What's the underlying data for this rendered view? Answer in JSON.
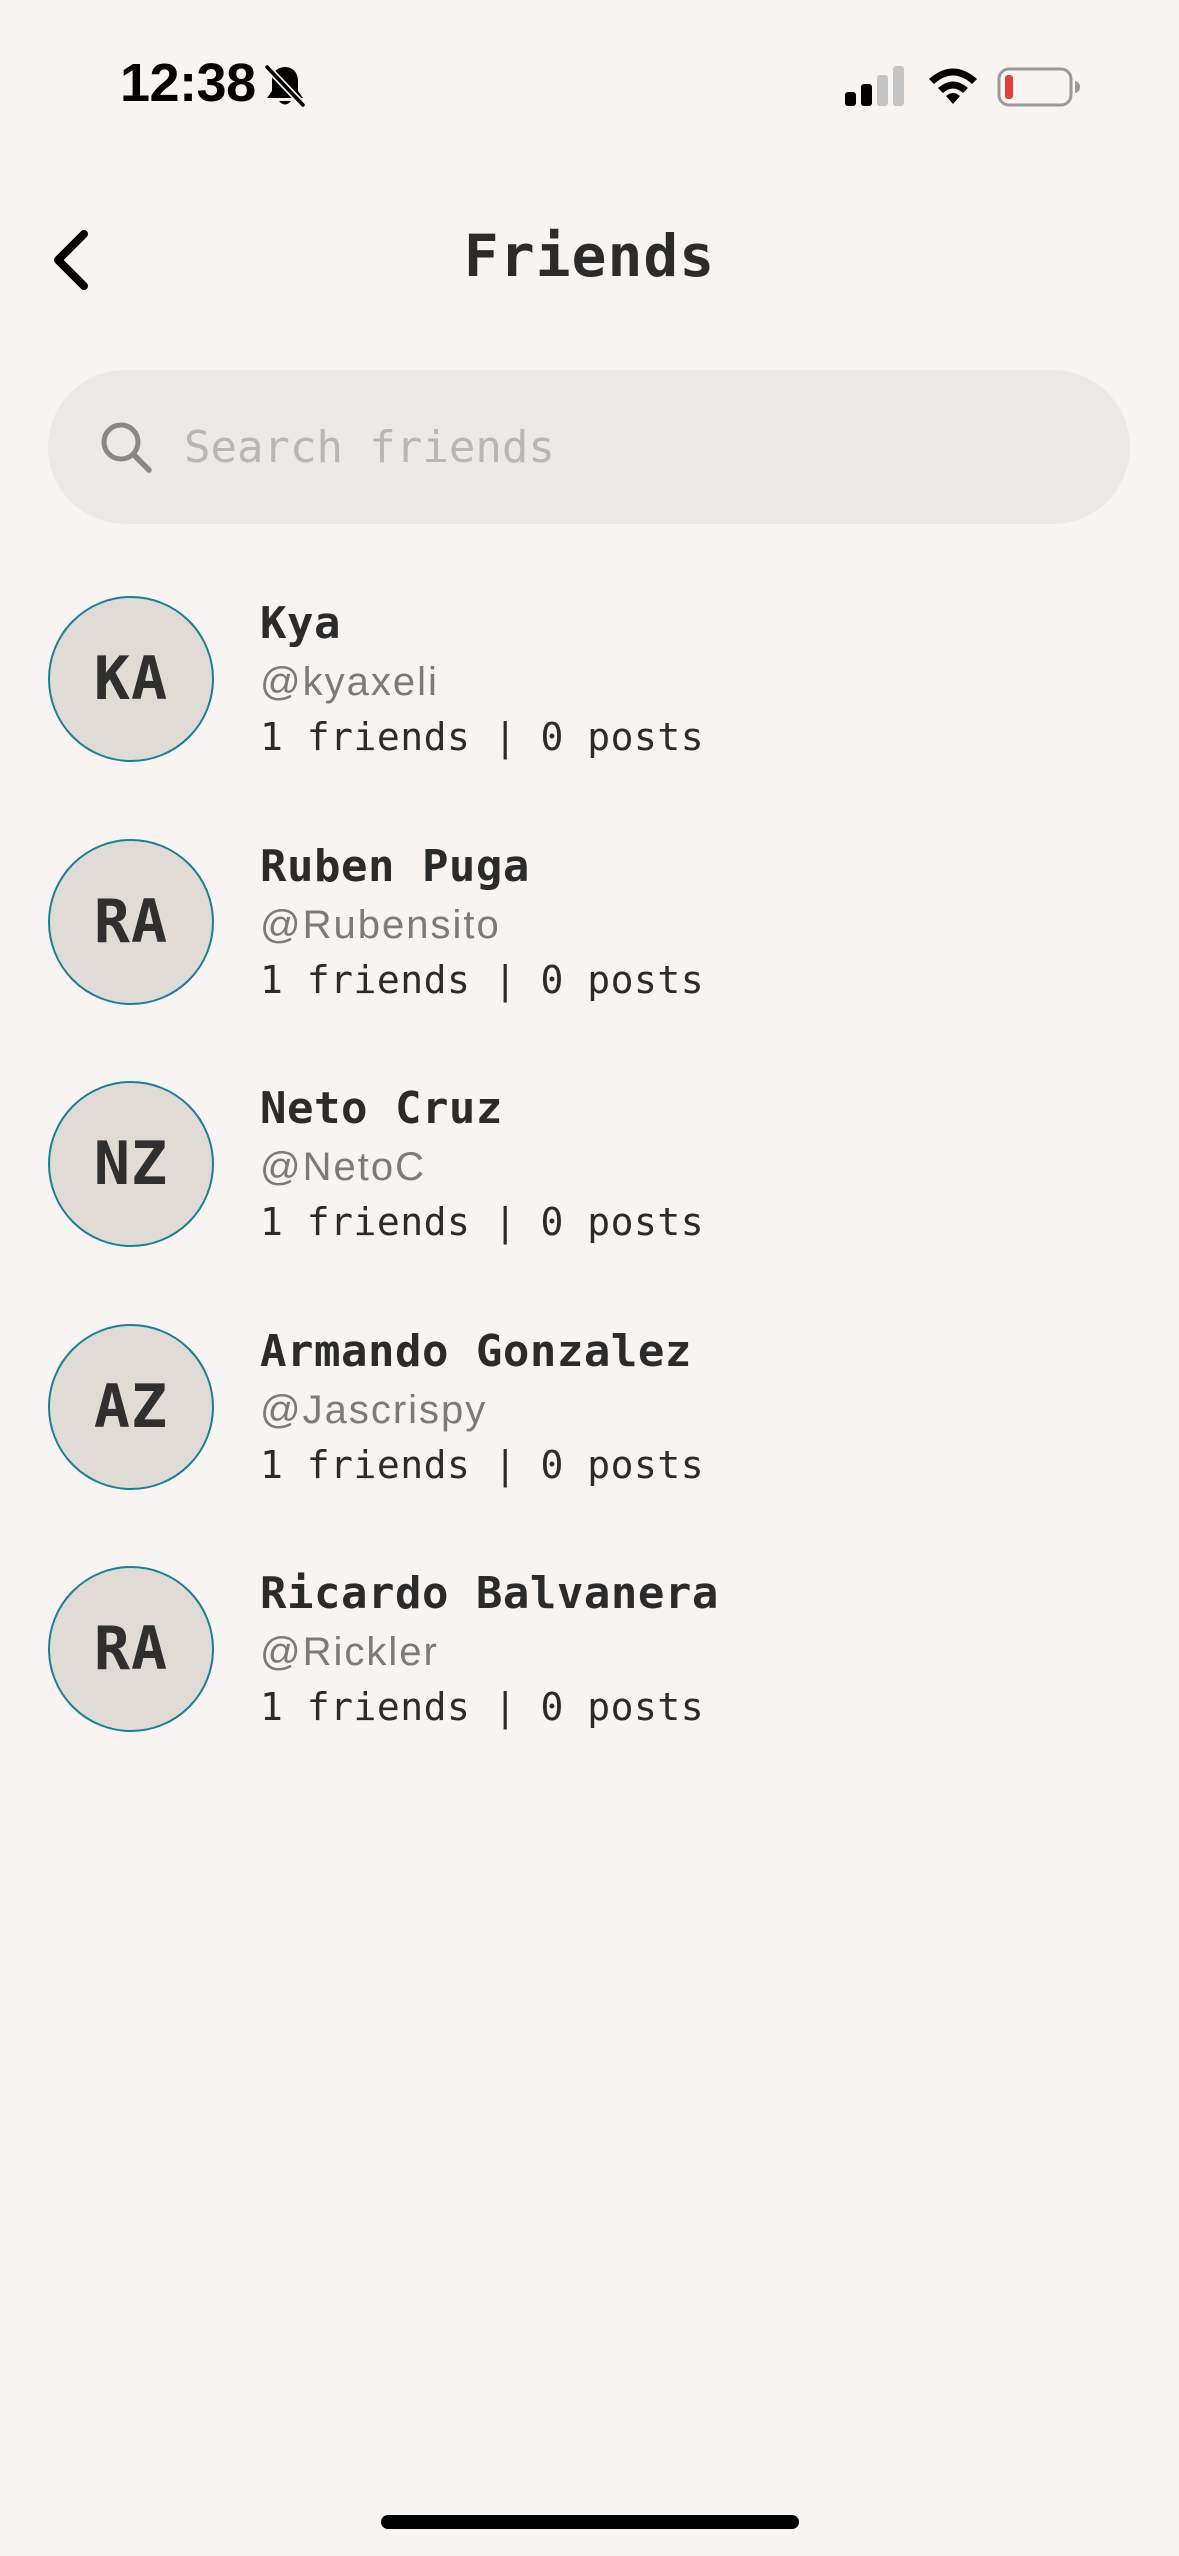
{
  "status_bar": {
    "time": "12:38",
    "battery_color": "#e0413a"
  },
  "header": {
    "title": "Friends"
  },
  "search": {
    "value": "",
    "placeholder": "Search friends"
  },
  "friends": [
    {
      "initials": "KA",
      "name": "Kya",
      "handle": "@kyaxeli",
      "stats": "1 friends | 0 posts"
    },
    {
      "initials": "RA",
      "name": "Ruben Puga",
      "handle": "@Rubensito",
      "stats": "1 friends | 0 posts"
    },
    {
      "initials": "NZ",
      "name": "Neto Cruz",
      "handle": "@NetoC",
      "stats": "1 friends | 0 posts"
    },
    {
      "initials": "AZ",
      "name": "Armando Gonzalez",
      "handle": "@Jascrispy",
      "stats": "1 friends | 0 posts"
    },
    {
      "initials": "RA",
      "name": "Ricardo Balvanera",
      "handle": "@Rickler",
      "stats": "1 friends | 0 posts"
    }
  ],
  "colors": {
    "background": "#f7f4f1",
    "search_background": "#ece9e7",
    "avatar_background": "#e1dbd6",
    "avatar_border": "#1a7f96"
  }
}
